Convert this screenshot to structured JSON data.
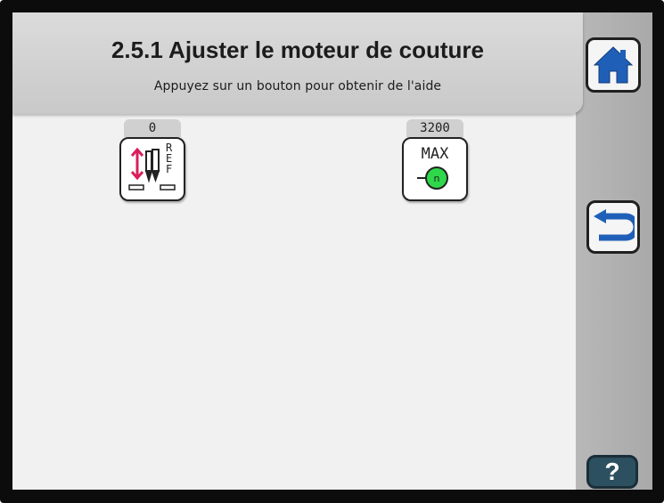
{
  "header": {
    "title": "2.5.1  Ajuster le moteur de couture",
    "subtitle": "Appuyez sur un bouton pour obtenir de l'aide"
  },
  "params": [
    {
      "name": "reference-position",
      "value": "0",
      "icon": "needle-reference-icon",
      "label": "REF"
    },
    {
      "name": "max-speed",
      "value": "3200",
      "icon": "motor-max-speed-icon",
      "label": "MAX"
    }
  ],
  "sidebar": {
    "home_icon": "home-icon",
    "back_icon": "back-arrow-icon",
    "help_label": "?"
  },
  "colors": {
    "accent_blue": "#1f5fb7",
    "needle_red": "#d81e5b",
    "motor_green": "#2fd84a",
    "help_button": "#2d5060"
  }
}
